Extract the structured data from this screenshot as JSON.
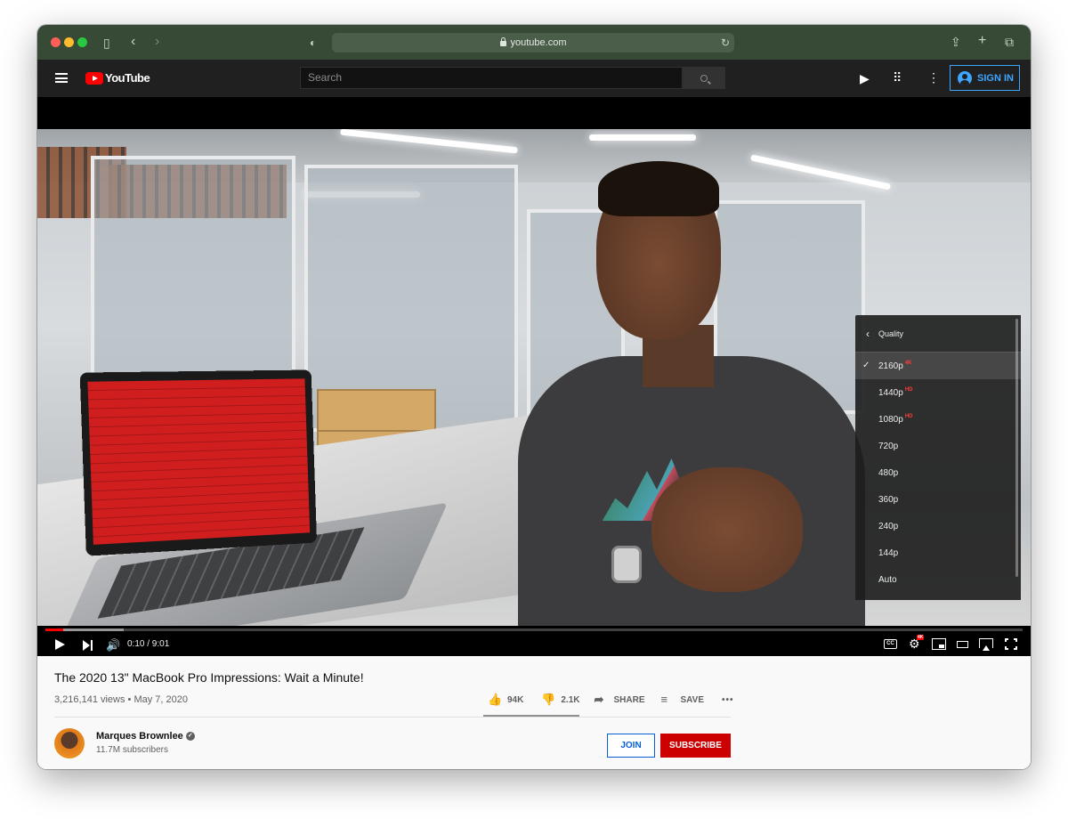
{
  "browser": {
    "address": "youtube.com",
    "icons": [
      "sidebar-icon",
      "back-icon",
      "forward-icon",
      "shield-icon",
      "lock-icon",
      "reload-icon",
      "share-icon",
      "new-tab-icon",
      "tabs-icon"
    ]
  },
  "header": {
    "logo_text": "YouTube",
    "search_placeholder": "Search",
    "sign_in_label": "SIGN IN"
  },
  "player": {
    "time_display": "0:10 / 9:01",
    "progress_fraction": 0.018,
    "buffer_fraction": 0.08,
    "cc_label": "CC",
    "settings_badge": "4K",
    "quality_menu": {
      "title": "Quality",
      "options": [
        {
          "label": "2160p",
          "badge": "4K",
          "selected": true
        },
        {
          "label": "1440p",
          "badge": "HD",
          "selected": false
        },
        {
          "label": "1080p",
          "badge": "HD",
          "selected": false
        },
        {
          "label": "720p",
          "badge": "",
          "selected": false
        },
        {
          "label": "480p",
          "badge": "",
          "selected": false
        },
        {
          "label": "360p",
          "badge": "",
          "selected": false
        },
        {
          "label": "240p",
          "badge": "",
          "selected": false
        },
        {
          "label": "144p",
          "badge": "",
          "selected": false
        },
        {
          "label": "Auto",
          "badge": "",
          "selected": false
        }
      ]
    }
  },
  "video": {
    "title": "The 2020 13\" MacBook Pro Impressions: Wait a Minute!",
    "meta": "3,216,141 views • May 7, 2020",
    "likes": "94K",
    "dislikes": "2.1K",
    "share_label": "SHARE",
    "save_label": "SAVE",
    "more_label": "•••"
  },
  "channel": {
    "name": "Marques Brownlee",
    "subscribers": "11.7M subscribers",
    "join_label": "JOIN",
    "subscribe_label": "SUBSCRIBE"
  },
  "colors": {
    "safari_bar": "#364a36",
    "yt_header": "#202020",
    "brand_red": "#ff0000",
    "subscribe_red": "#cc0000",
    "link_blue": "#065fd4",
    "signin_blue": "#3ea6ff"
  }
}
